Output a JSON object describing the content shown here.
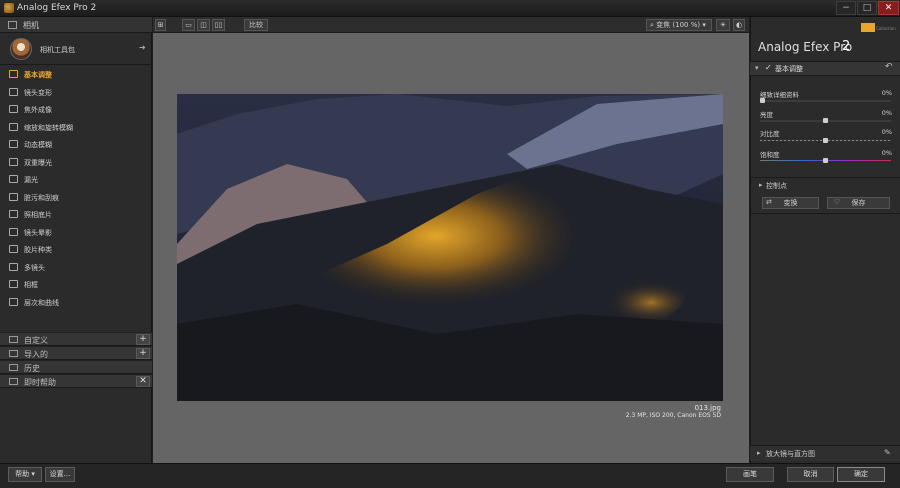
{
  "window": {
    "title": "Analog Efex Pro 2",
    "minimize": "−",
    "maximize": "□",
    "close": "✕"
  },
  "left_panel": {
    "header": "相机",
    "toolkit_label": "相机工具包",
    "toolkit_arrow": "➜",
    "tools": [
      {
        "label": "基本调整",
        "active": true
      },
      {
        "label": "镜头变形",
        "active": false
      },
      {
        "label": "焦外成像",
        "active": false
      },
      {
        "label": "缩放和旋转模糊",
        "active": false
      },
      {
        "label": "动态模糊",
        "active": false
      },
      {
        "label": "双重曝光",
        "active": false
      },
      {
        "label": "漏光",
        "active": false
      },
      {
        "label": "脏污和刮痕",
        "active": false
      },
      {
        "label": "照相底片",
        "active": false
      },
      {
        "label": "镜头晕影",
        "active": false
      },
      {
        "label": "胶片种类",
        "active": false
      },
      {
        "label": "多镜头",
        "active": false
      },
      {
        "label": "相框",
        "active": false
      },
      {
        "label": "层次和曲线",
        "active": false
      }
    ],
    "sections": [
      {
        "label": "自定义",
        "button": "+"
      },
      {
        "label": "导入的",
        "button": "+"
      },
      {
        "label": "历史",
        "button": ""
      },
      {
        "label": "即时帮助",
        "button": "✕"
      }
    ]
  },
  "toolbar": {
    "compare_label": "比较",
    "zoom_label": "变焦 (100 %)",
    "zoom_arrow": "▾"
  },
  "canvas": {
    "file_name": "013.jpg",
    "file_info": "2.3 MP, ISO 200, Canon EOS 5D"
  },
  "right_panel": {
    "collection": "Collection",
    "product_title": "Analog Efex Pro",
    "product_num": "2",
    "filter_title": "基本调整",
    "filter_check": "✓",
    "filter_chevron": "▾",
    "filter_reset": "↶",
    "sliders": [
      {
        "label": "细致详细资料",
        "value": "0%",
        "level": 0.0
      },
      {
        "label": "亮度",
        "value": "0%",
        "level": 0.5
      },
      {
        "label": "对比度",
        "value": "0%",
        "level": 0.5
      },
      {
        "label": "饱和度",
        "value": "0%",
        "level": 0.5
      }
    ],
    "control_points_label": "控制点",
    "control_points_chevron": "▸",
    "transform_label": "变换",
    "save_label": "保存",
    "loupe_label": "放大镜与直方图",
    "loupe_chevron": "▸"
  },
  "bottom": {
    "help_label": "帮助 ▾",
    "settings_label": "设置...",
    "brush_label": "画笔",
    "cancel_label": "取消",
    "ok_label": "确定"
  },
  "colors": {
    "accent": "#e8a62c",
    "canvas_bg": "#656565",
    "panel_bg": "#2b2b2b"
  }
}
